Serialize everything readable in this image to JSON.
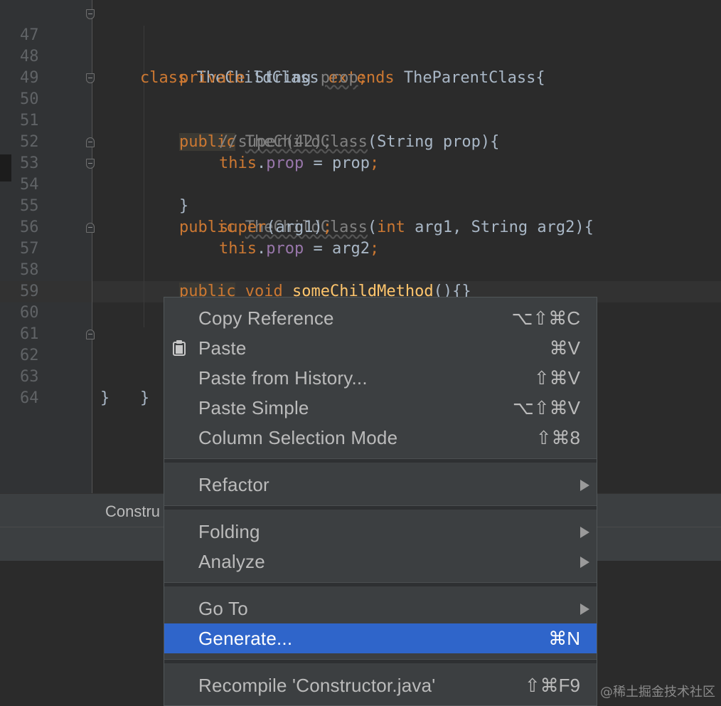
{
  "editor": {
    "lines": [
      {
        "n": "47"
      },
      {
        "n": "48"
      },
      {
        "n": "49"
      },
      {
        "n": "50"
      },
      {
        "n": "51"
      },
      {
        "n": "52"
      },
      {
        "n": "53"
      },
      {
        "n": "54"
      },
      {
        "n": "55"
      },
      {
        "n": "56"
      },
      {
        "n": "57"
      },
      {
        "n": "58"
      },
      {
        "n": "59"
      },
      {
        "n": "60"
      },
      {
        "n": "61"
      },
      {
        "n": "62"
      },
      {
        "n": "63"
      },
      {
        "n": "64"
      }
    ],
    "code": {
      "l47": {
        "kw1": "class",
        "t1": " TheChildClass ",
        "kw2": "extends",
        "t2": " TheParentClass{"
      },
      "l48": {
        "kw1": "private",
        "t1": " String ",
        "prop": "prop",
        "semi": ";"
      },
      "l50": {
        "kw1": "public",
        "sp": " ",
        "ctor": "TheChildClass",
        "t1": "(String prop){"
      },
      "l51": {
        "comment": "//super(42);"
      },
      "l52": {
        "kw1": "this",
        "dot": ".",
        "prop": "prop",
        "t1": " = prop",
        "semi": ";"
      },
      "l53": {
        "t1": "}"
      },
      "l54": {
        "kw1": "public",
        "sp": " ",
        "ctor": "TheChildClass",
        "t1": "(",
        "kw2": "int",
        "t2": " arg1, String arg2){"
      },
      "l55": {
        "kw1": "super",
        "t1": "(arg1)",
        "semi": ";"
      },
      "l56": {
        "kw1": "this",
        "dot": ".",
        "prop": "prop",
        "t1": " = arg2",
        "semi": ";"
      },
      "l57": {
        "t1": "}"
      },
      "l58": {
        "kw1": "public",
        "sp": " ",
        "kw2": "void",
        "sp2": " ",
        "fn": "someChildMethod",
        "t1": "(){}"
      },
      "l62": {
        "t1": "}"
      },
      "l63": {
        "t1": "}"
      }
    }
  },
  "bottom_tab": {
    "label": "Constru"
  },
  "context_menu": {
    "items": [
      {
        "label": "Copy Reference",
        "shortcut": "⌥⇧⌘C"
      },
      {
        "label": "Paste",
        "shortcut": "⌘V",
        "icon": "clipboard-icon"
      },
      {
        "label": "Paste from History...",
        "shortcut": "⇧⌘V"
      },
      {
        "label": "Paste Simple",
        "shortcut": "⌥⇧⌘V"
      },
      {
        "label": "Column Selection Mode",
        "shortcut": "⇧⌘8"
      },
      {
        "label": "Refactor",
        "submenu": true
      },
      {
        "label": "Folding",
        "submenu": true
      },
      {
        "label": "Analyze",
        "submenu": true
      },
      {
        "label": "Go To",
        "submenu": true
      },
      {
        "label": "Generate...",
        "shortcut": "⌘N",
        "selected": true
      },
      {
        "label": "Recompile 'Constructor.java'",
        "shortcut": "⇧⌘F9"
      }
    ],
    "selected_color": "#2f65ca"
  },
  "watermark": "@稀土掘金技术社区"
}
